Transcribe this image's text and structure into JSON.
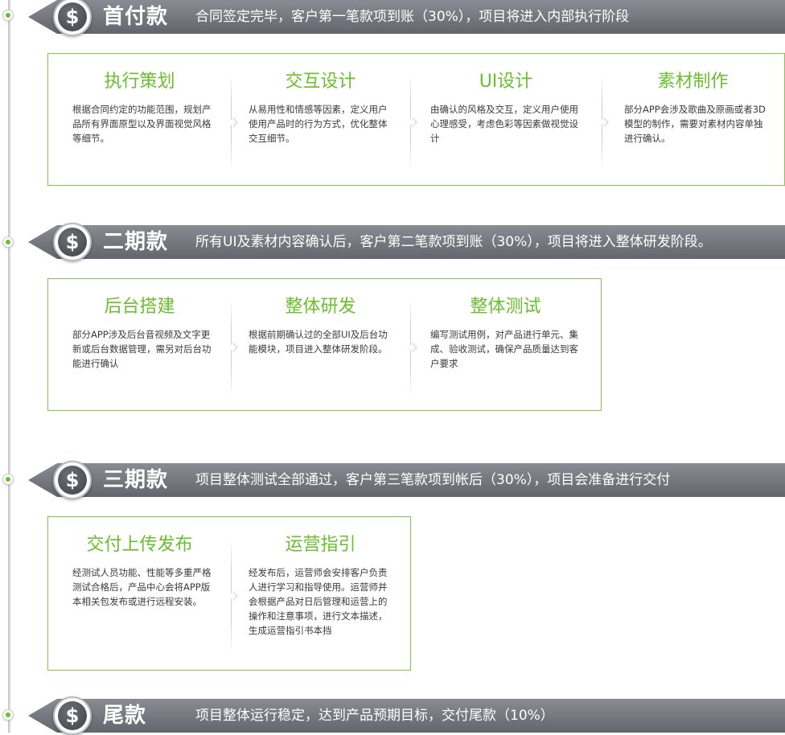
{
  "colors": {
    "accent": "#6abf2e",
    "bar": "#6f7379",
    "border": "#82c84a"
  },
  "phases": [
    {
      "icon": "dollar-coin-icon",
      "coin_symbol": "$",
      "name": "首付款",
      "desc": "合同签定完毕，客户第一笔款项到账（30%），项目将进入内部执行阶段",
      "steps": [
        {
          "title": "执行策划",
          "text": "根据合同约定的功能范围，规划产品所有界面原型以及界面视觉风格等细节。"
        },
        {
          "title": "交互设计",
          "text": "从易用性和情感等因素，定义用户使用产品时的行为方式，优化整体交互细节。"
        },
        {
          "title": "UI设计",
          "text": "由确认的风格及交互，定义用户使用心理感受，考虑色彩等因素做视觉设计"
        },
        {
          "title": "素材制作",
          "text": "部分APP会涉及歌曲及原画或者3D模型的制作，需要对素材内容单独进行确认。"
        }
      ]
    },
    {
      "icon": "dollar-coin-icon",
      "coin_symbol": "$",
      "name": "二期款",
      "desc": "所有UI及素材内容确认后，客户第二笔款项到账（30%），项目将进入整体研发阶段。",
      "steps": [
        {
          "title": "后台搭建",
          "text": "部分APP涉及后台音视频及文字更新或后台数据管理，需另对后台功能进行确认"
        },
        {
          "title": "整体研发",
          "text": "根据前期确认过的全部UI及后台功能模块，项目进入整体研发阶段。"
        },
        {
          "title": "整体测试",
          "text": "编写测试用例，对产品进行单元、集成、验收测试，确保产品质量达到客户要求"
        }
      ]
    },
    {
      "icon": "dollar-coin-icon",
      "coin_symbol": "$",
      "name": "三期款",
      "desc": "项目整体测试全部通过，客户第三笔款项到帐后（30%），项目会准备进行交付",
      "steps": [
        {
          "title": "交付上传发布",
          "text": "经测试人员功能、性能等多重严格测试合格后，产品中心会将APP版本相关包发布或进行远程安装。"
        },
        {
          "title": "运营指引",
          "text": "经发布后，运营师会安排客户负责人进行学习和指导使用。运营师并会根据产品对日后管理和运营上的操作和注意事项，进行文本描述，生成运营指引书本挡"
        }
      ]
    },
    {
      "icon": "dollar-coin-icon",
      "coin_symbol": "$",
      "name": "尾款",
      "desc": "项目整体运行稳定，达到产品预期目标，交付尾款（10%）",
      "steps": []
    }
  ]
}
